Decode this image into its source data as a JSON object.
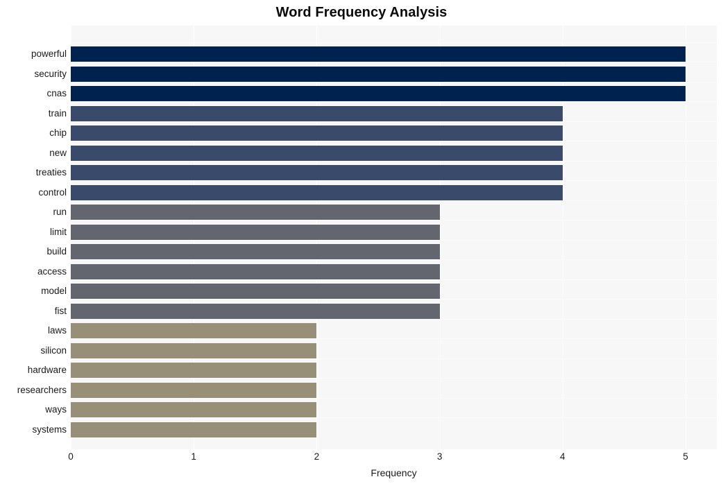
{
  "chart_data": {
    "type": "bar",
    "orientation": "horizontal",
    "title": "Word Frequency Analysis",
    "xlabel": "Frequency",
    "ylabel": "",
    "xlim": [
      0,
      5
    ],
    "xticks": [
      0,
      1,
      2,
      3,
      4,
      5
    ],
    "xtick_labels": [
      "0",
      "1",
      "2",
      "3",
      "4",
      "5"
    ],
    "grid": true,
    "grid_axis": "x",
    "legend": false,
    "categories": [
      "powerful",
      "security",
      "cnas",
      "train",
      "chip",
      "new",
      "treaties",
      "control",
      "run",
      "limit",
      "build",
      "access",
      "model",
      "fist",
      "laws",
      "silicon",
      "hardware",
      "researchers",
      "ways",
      "systems"
    ],
    "values": [
      5,
      5,
      5,
      4,
      4,
      4,
      4,
      4,
      3,
      3,
      3,
      3,
      3,
      3,
      2,
      2,
      2,
      2,
      2,
      2
    ],
    "bar_colors": [
      "#00224e",
      "#00224e",
      "#00224e",
      "#3a4a6b",
      "#3a4a6b",
      "#3a4a6b",
      "#3a4a6b",
      "#3a4a6b",
      "#63666f",
      "#63666f",
      "#63666f",
      "#63666f",
      "#63666f",
      "#63666f",
      "#978f77",
      "#978f77",
      "#978f77",
      "#978f77",
      "#978f77",
      "#978f77"
    ],
    "colors": {
      "plot_background": "#f7f7f7",
      "figure_background": "#ffffff",
      "gridline": "#ffffff",
      "text": "#1a1a1a",
      "title": "#0a0a0a"
    }
  }
}
